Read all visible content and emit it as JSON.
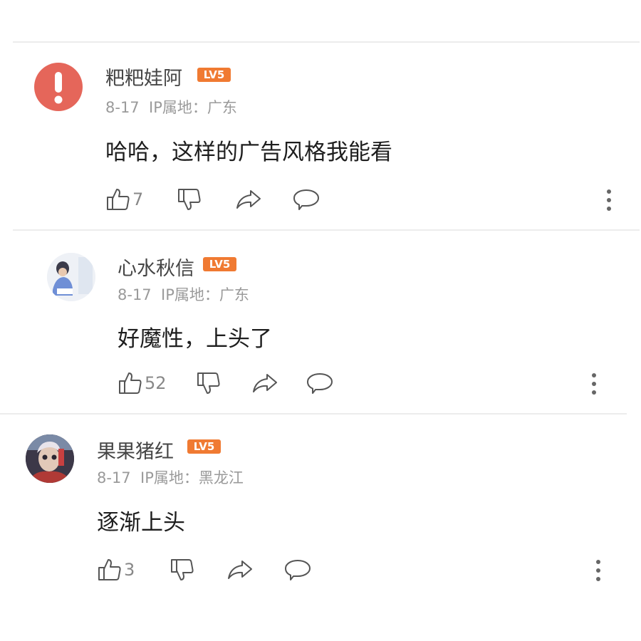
{
  "comments": [
    {
      "user": "粑粑娃阿",
      "level": "LV5",
      "date": "8-17",
      "ip_label": "IP属地：",
      "ip_location": "广东",
      "text": "哈哈，这样的广告风格我能看",
      "likes": "7",
      "avatar_icon": "exclamation-icon"
    },
    {
      "user": "心水秋信",
      "level": "LV5",
      "date": "8-17",
      "ip_label": "IP属地：",
      "ip_location": "广东",
      "text": "好魔性，上头了",
      "likes": "52",
      "avatar_icon": "photo-avatar"
    },
    {
      "user": "果果猪红",
      "level": "LV5",
      "date": "8-17",
      "ip_label": "IP属地：",
      "ip_location": "黑龙江",
      "text": "逐渐上头",
      "likes": "3",
      "avatar_icon": "photo-avatar"
    }
  ],
  "colors": {
    "badge": "#f07a32",
    "warning_avatar": "#e5665a",
    "meta_text": "#9a9a9a",
    "icon_stroke": "#555555"
  }
}
